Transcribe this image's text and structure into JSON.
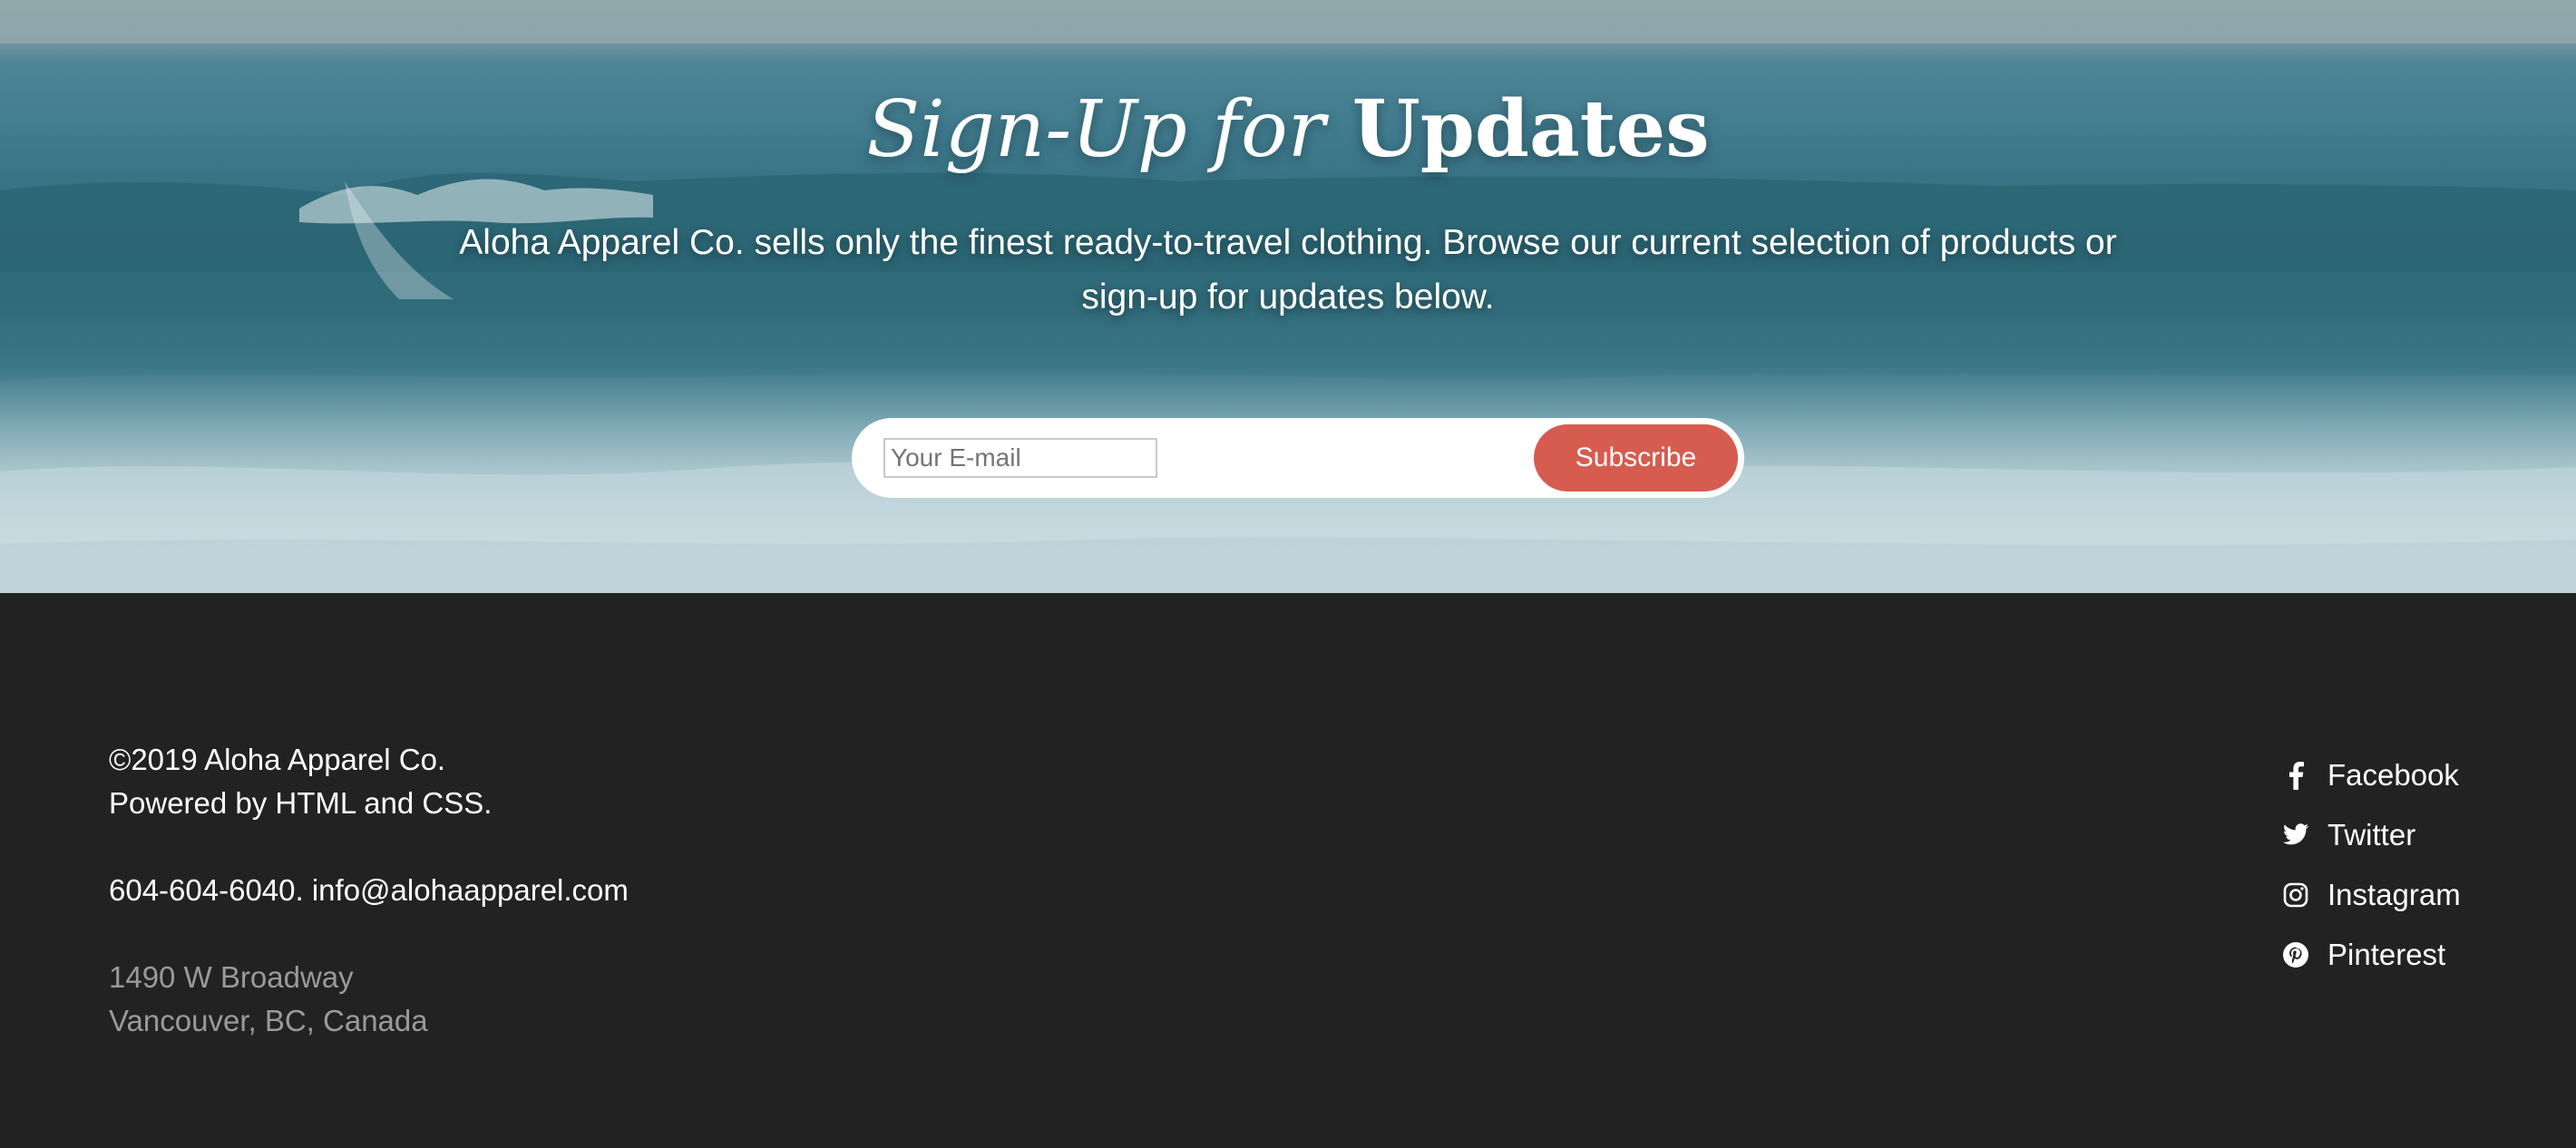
{
  "hero": {
    "title_italic": "Sign-Up for",
    "title_bold": "Updates",
    "description": "Aloha Apparel Co. sells only the finest ready-to-travel clothing. Browse our current selection of products or sign-up for updates below."
  },
  "subscribe": {
    "email_placeholder": "Your E-mail",
    "email_value": "",
    "button_label": "Subscribe"
  },
  "footer": {
    "copyright": "©2019 Aloha Apparel Co.",
    "powered_by": "Powered by HTML and CSS.",
    "contact": "604-604-6040. info@alohaapparel.com",
    "address_line1": "1490 W Broadway",
    "address_line2": "Vancouver, BC, Canada"
  },
  "social": [
    {
      "label": "Facebook",
      "icon": "facebook-icon"
    },
    {
      "label": "Twitter",
      "icon": "twitter-icon"
    },
    {
      "label": "Instagram",
      "icon": "instagram-icon"
    },
    {
      "label": "Pinterest",
      "icon": "pinterest-icon"
    }
  ],
  "colors": {
    "footer_bg": "#222222",
    "subscribe_button": "#d65c50",
    "muted_text": "#9a9a9a"
  }
}
